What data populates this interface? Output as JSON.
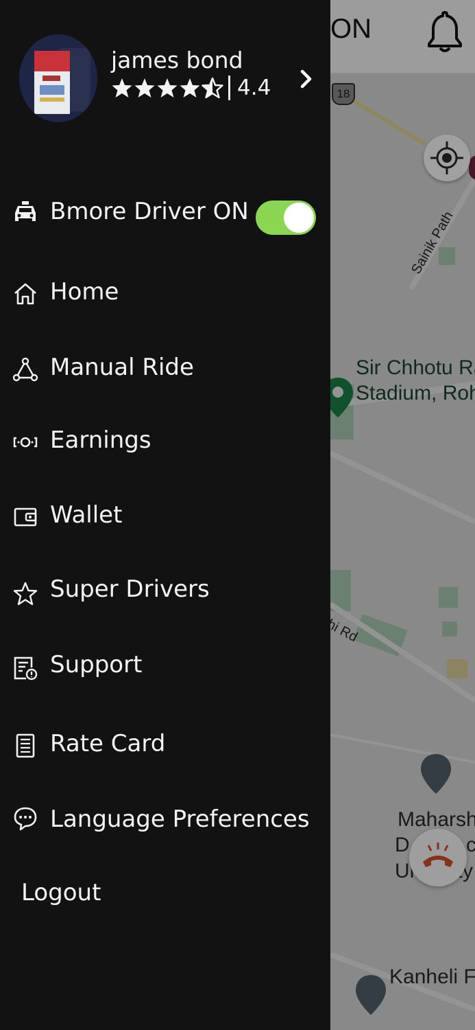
{
  "map": {
    "status_text": "ON",
    "route_shield": "18",
    "labels": {
      "road_1": "Sainik Path",
      "stadium_line1": "Sir Chhotu Ran",
      "stadium_line2": "Stadium, Roht",
      "road_2": "hi Rd",
      "university_line1": "Maharshi",
      "university_line2": "D",
      "university_line2b": "c",
      "university_line3": "Ur",
      "university_line3b": "ity",
      "flyover": "Kanheli Fly"
    },
    "icons": {
      "bell": "notification-bell-icon",
      "locate": "my-location-icon",
      "call": "end-call-icon"
    }
  },
  "profile": {
    "name": "james bond",
    "rating": "4.4",
    "stars": [
      1,
      1,
      1,
      1,
      0.5
    ],
    "accent": "#8bd650"
  },
  "menu": {
    "driver_status": {
      "label": "Bmore Driver ON",
      "icon": "taxi-icon",
      "toggle_on": true
    },
    "items": [
      {
        "label": "Home",
        "icon": "home-icon"
      },
      {
        "label": "Manual Ride",
        "icon": "network-icon"
      },
      {
        "label": "Earnings",
        "icon": "earnings-icon"
      },
      {
        "label": "Wallet",
        "icon": "wallet-icon"
      },
      {
        "label": "Super Drivers",
        "icon": "star-icon"
      },
      {
        "label": "Support",
        "icon": "support-icon"
      },
      {
        "label": "Rate Card",
        "icon": "rate-card-icon"
      },
      {
        "label": "Language Preferences",
        "icon": "chat-icon"
      }
    ],
    "logout": "Logout"
  }
}
